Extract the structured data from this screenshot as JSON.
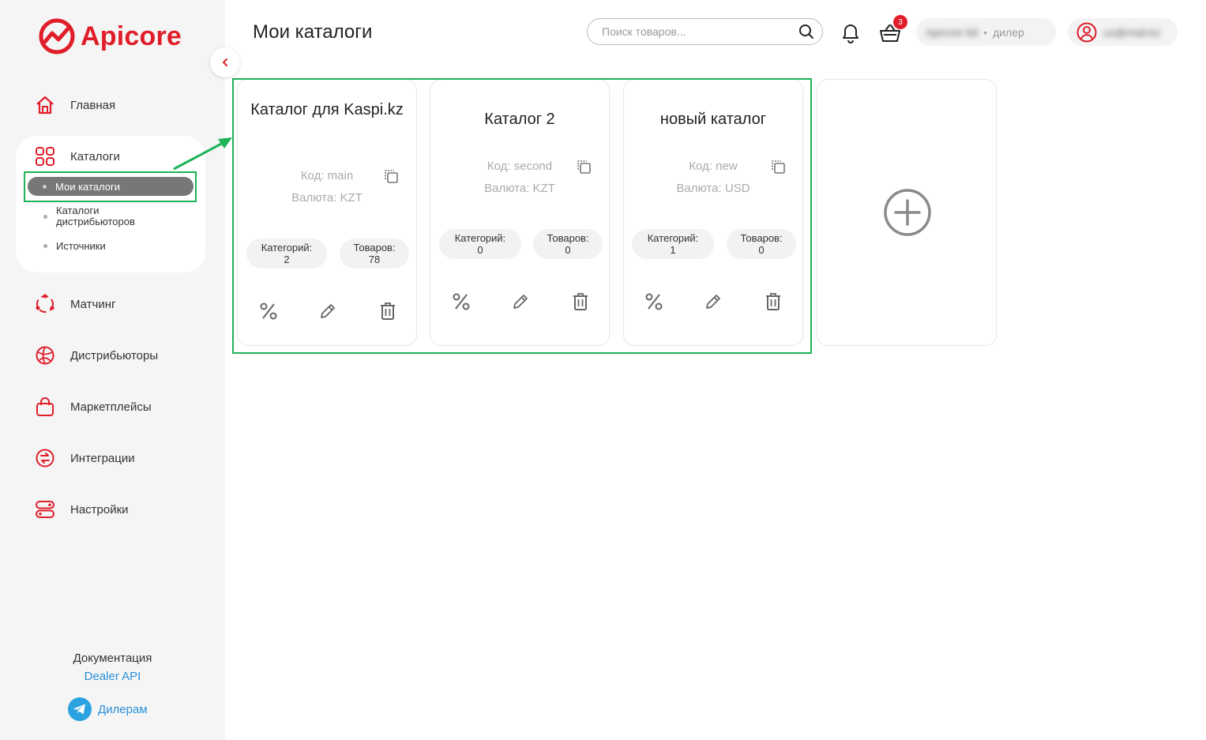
{
  "brand": {
    "name": "Apicore",
    "color": "#e01e2a"
  },
  "sidebar": {
    "nav": [
      {
        "label": "Главная",
        "icon": "home-icon"
      },
      {
        "label": "Каталоги",
        "icon": "grid-icon"
      },
      {
        "label": "Матчинг",
        "icon": "matching-icon"
      },
      {
        "label": "Дистрибьюторы",
        "icon": "globe-icon"
      },
      {
        "label": "Маркетплейсы",
        "icon": "bag-icon"
      },
      {
        "label": "Интеграции",
        "icon": "integrations-icon"
      },
      {
        "label": "Настройки",
        "icon": "settings-icon"
      }
    ],
    "catalog_sub": {
      "active": "Мои каталоги",
      "distributors": "Каталоги дистрибьюторов",
      "sources": "Источники"
    },
    "docs_label": "Документация",
    "docs_link": "Dealer API",
    "telegram_label": "Дилерам"
  },
  "header": {
    "title": "Мои каталоги",
    "search_placeholder": "Поиск товаров...",
    "cart_count": "3",
    "company_name": "Apicore ltd",
    "role": "дилер",
    "user_email": "us@mail.kz"
  },
  "labels": {
    "code": "Код:",
    "currency": "Валюта:",
    "categories": "Категорий:",
    "products": "Товаров:"
  },
  "catalogs": [
    {
      "title": "Каталог для Kaspi.kz",
      "code": "main",
      "currency": "KZT",
      "categories": "2",
      "products": "78"
    },
    {
      "title": "Каталог 2",
      "code": "second",
      "currency": "KZT",
      "categories": "0",
      "products": "0"
    },
    {
      "title": "новый каталог",
      "code": "new",
      "currency": "USD",
      "categories": "1",
      "products": "0"
    }
  ],
  "colors": {
    "highlight": "#1db356",
    "accent": "#e01e2a",
    "link": "#2a8fd8"
  }
}
